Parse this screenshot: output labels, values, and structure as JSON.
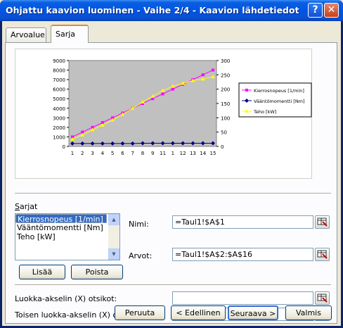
{
  "window": {
    "title": "Ohjattu kaavion luominen - Vaihe 2/4 - Kaavion lähdetiedot",
    "help_glyph": "?",
    "close_glyph": "✕"
  },
  "tabs": [
    {
      "label": "Arvoalue",
      "active": false
    },
    {
      "label": "Sarja",
      "active": true
    }
  ],
  "chart_data": {
    "type": "line",
    "x": [
      1,
      2,
      3,
      4,
      5,
      6,
      7,
      8,
      9,
      10,
      11,
      12,
      13,
      14,
      15
    ],
    "categories": [
      "1",
      "2",
      "3",
      "4",
      "5",
      "6",
      "7",
      "8",
      "9",
      "11",
      "1",
      "12",
      "13",
      "14",
      "15"
    ],
    "y_left_ticks": [
      "0",
      "1000",
      "2000",
      "3000",
      "4000",
      "5000",
      "6000",
      "7000",
      "8000",
      "9000"
    ],
    "y_right_ticks": [
      "0",
      "50",
      "100",
      "150",
      "200",
      "250",
      "300"
    ],
    "ylim_left": [
      0,
      9000
    ],
    "ylim_right": [
      0,
      300
    ],
    "plot_background": "#c0c0c0",
    "legend_position": "right",
    "series": [
      {
        "name": "Kierrosnopeus [1/min]",
        "axis": "left",
        "color": "#ff00ff",
        "marker": "square",
        "values": [
          1000,
          1500,
          2000,
          2500,
          3000,
          3500,
          4000,
          4500,
          5000,
          5500,
          6000,
          6500,
          7000,
          7500,
          8000
        ]
      },
      {
        "name": "Vääntömomentti [Nm]",
        "axis": "right",
        "color": "#000080",
        "marker": "diamond",
        "values": [
          10,
          10,
          10,
          10,
          10,
          10,
          10,
          11,
          11,
          11,
          11,
          11,
          11,
          11,
          11
        ]
      },
      {
        "name": "Teho [kW]",
        "axis": "right",
        "color": "#ffff00",
        "marker": "triangle",
        "values": [
          25,
          40,
          58,
          74,
          92,
          112,
          133,
          155,
          175,
          195,
          210,
          220,
          230,
          235,
          243
        ]
      }
    ]
  },
  "series_section": {
    "label": "Sarjat",
    "items": [
      {
        "label": "Kierrosnopeus [1/min]",
        "selected": true
      },
      {
        "label": "Vääntömomentti [Nm]",
        "selected": false
      },
      {
        "label": "Teho [kW]",
        "selected": false
      }
    ],
    "add_button": "Lisää",
    "remove_button": "Poista",
    "name_label": "Nimi:",
    "name_value": "=Taul1!$A$1",
    "values_label": "Arvot:",
    "values_value": "=Taul1!$A$2:$A$16"
  },
  "axis_section": {
    "x_axis_label": "Luokka-akselin (X) otsikot:",
    "x_axis_value": "",
    "secondary_x_axis_label": "Toisen luokka-akselin (X) otsikot:",
    "secondary_x_axis_value": ""
  },
  "footer": {
    "cancel": "Peruuta",
    "back": "< Edellinen",
    "next": "Seuraava >",
    "finish": "Valmis"
  }
}
